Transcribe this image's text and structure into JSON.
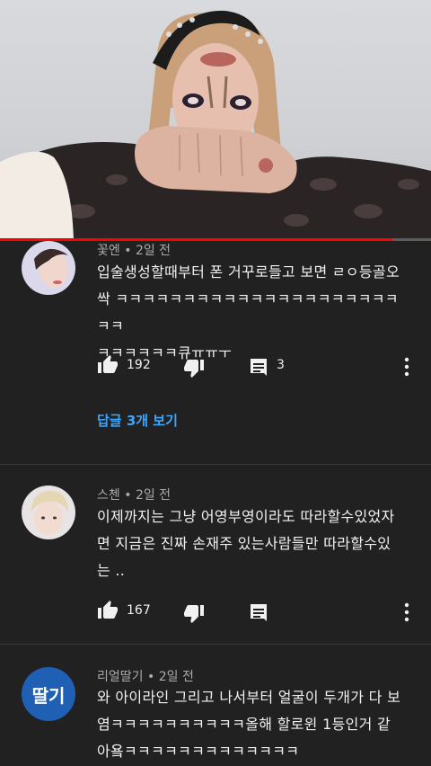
{
  "video": {
    "progress": 0.91,
    "accent": "#ff0000"
  },
  "comments": [
    {
      "author": "꽃엔",
      "time": "2일 전",
      "lines": [
        "입술생성할때부터 폰 거꾸로들고 보면 ㄹㅇ등골오",
        "싹 ㅋㅋㅋㅋㅋㅋㅋㅋㅋㅋㅋㅋㅋㅋㅋㅋㅋㅋㅋㅋㅋㅋㅋ",
        "ㅋㅋㅋㅋㅋㅋ큐ㅠㅠㅜ"
      ],
      "likes": "192",
      "replies_count": "3",
      "view_replies": "답글 3개 보기"
    },
    {
      "author": "스첸",
      "time": "2일 전",
      "lines": [
        "이제까지는 그냥 어영부영이라도 따라할수있었자",
        "면 지금은 진짜 손재주 있는사람들만 따라할수있",
        "는 .."
      ],
      "likes": "167"
    },
    {
      "author": "리얼딸기",
      "time": "2일 전",
      "avatar_text": "딸기",
      "lines": [
        "와 아이라인 그리고 나서부터 얼굴이 두개가 다 보",
        "염ㅋㅋㅋㅋㅋㅋㅋㅋㅋㅋ올해 할로윈 1등인거 같",
        "아욬ㅋㅋㅋㅋㅋㅋㅋㅋㅋㅋㅋㅋㅋ"
      ]
    }
  ],
  "icons": {
    "like": "thumbs-up-icon",
    "dislike": "thumbs-down-icon",
    "reply": "reply-icon",
    "more": "more-vert-icon"
  },
  "colors": {
    "background": "#212121",
    "link": "#3ea6ff",
    "meta": "#aaaaaa"
  }
}
